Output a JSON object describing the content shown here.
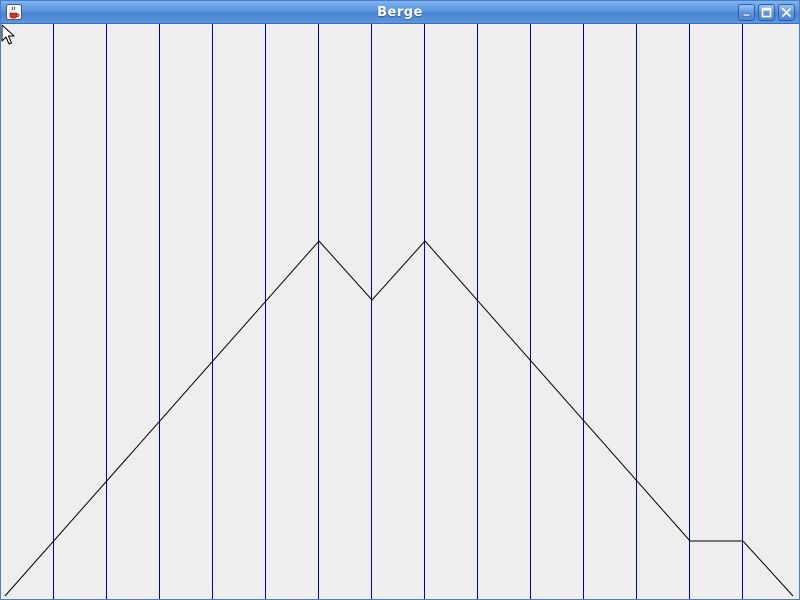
{
  "window": {
    "title": "Berge",
    "app_icon": "java-cup-icon",
    "controls": [
      "minimize-icon",
      "maximize-icon",
      "close-icon"
    ]
  },
  "canvas": {
    "background": "#eeeeee",
    "grid_color": "#0000cc",
    "grid_line_count": 14,
    "profile_color": "#000000",
    "cursor": "pointer-arrow-icon"
  }
}
